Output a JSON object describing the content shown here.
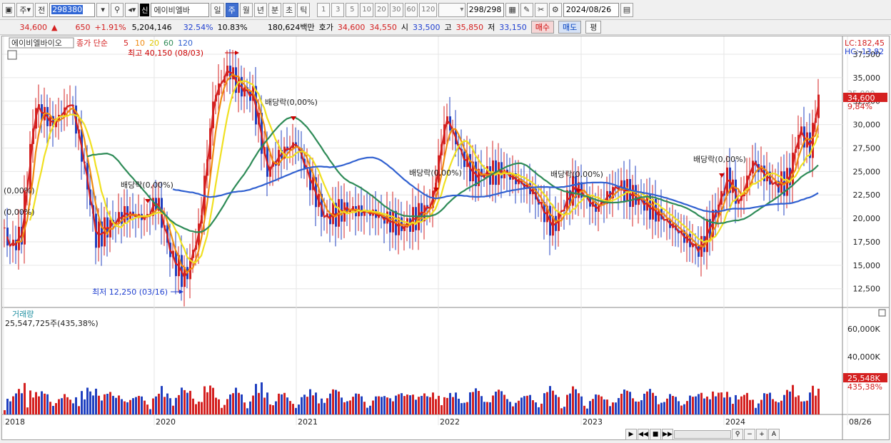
{
  "toolbar": {
    "period_mode": "주",
    "prev_label": "전",
    "code": "298380",
    "new_badge": "신",
    "name": "에이비엘바",
    "periods": [
      "일",
      "주",
      "월",
      "년",
      "분",
      "초",
      "틱"
    ],
    "active_period": "주",
    "intervals": [
      "1",
      "3",
      "5",
      "10",
      "20",
      "30",
      "60",
      "120"
    ],
    "count": "298/298",
    "date": "2024/08/26"
  },
  "infobar": {
    "price": "34,600",
    "change": "650",
    "change_pct": "+1.91%",
    "volume": "5,204,146",
    "vol_ratio": "32.54%",
    "turnover": "10.83%",
    "amount": "180,624백만",
    "ask_label": "호가",
    "ask1": "34,600",
    "ask2": "34,550",
    "open_label": "시",
    "open": "33,500",
    "high_label": "고",
    "high": "35,850",
    "low_label": "저",
    "low": "33,150",
    "buy_label": "매수",
    "sell_label": "매도",
    "flat_label": "평"
  },
  "legend": {
    "name": "에이비엘바이오",
    "ma_label": "종가 단순",
    "ma_periods": [
      {
        "p": "5",
        "color": "#d42020"
      },
      {
        "p": "10",
        "color": "#f08a10"
      },
      {
        "p": "20",
        "color": "#f0e020"
      },
      {
        "p": "60",
        "color": "#2e8b57"
      },
      {
        "p": "120",
        "color": "#3060d0"
      }
    ]
  },
  "annotations": {
    "high": "최고 40,150 (08/03)",
    "low": "최저 12,250 (03/16)",
    "dividends": [
      "배당락(0,00%)",
      "배당락(0,00%)",
      "배당락(0,00%)",
      "배당락(0,00%)",
      "배당락(0,00%)",
      "(0,00%)",
      "(0,00%)"
    ],
    "lc": "LC:182,45",
    "hc": "HC:-13,82",
    "last_price": "34,600",
    "last_pct": "9,84%",
    "overlap": "35,000"
  },
  "volume_panel": {
    "title": "거래량",
    "summary": "25,547,725주(435,38%)",
    "last_vol": "25,548K",
    "last_pct": "435,38%",
    "axis": [
      "60,000K",
      "40,000K"
    ]
  },
  "chart_data": {
    "type": "candlestick",
    "y_ticks": [
      "37,500",
      "35,000",
      "32,500",
      "30,000",
      "27,500",
      "25,000",
      "22,500",
      "20,000",
      "17,500",
      "15,000",
      "12,500"
    ],
    "x_labels": [
      "2018",
      "2020",
      "2021",
      "2022",
      "2023",
      "2024",
      "08/26"
    ],
    "ylim": [
      10500,
      39400
    ]
  }
}
